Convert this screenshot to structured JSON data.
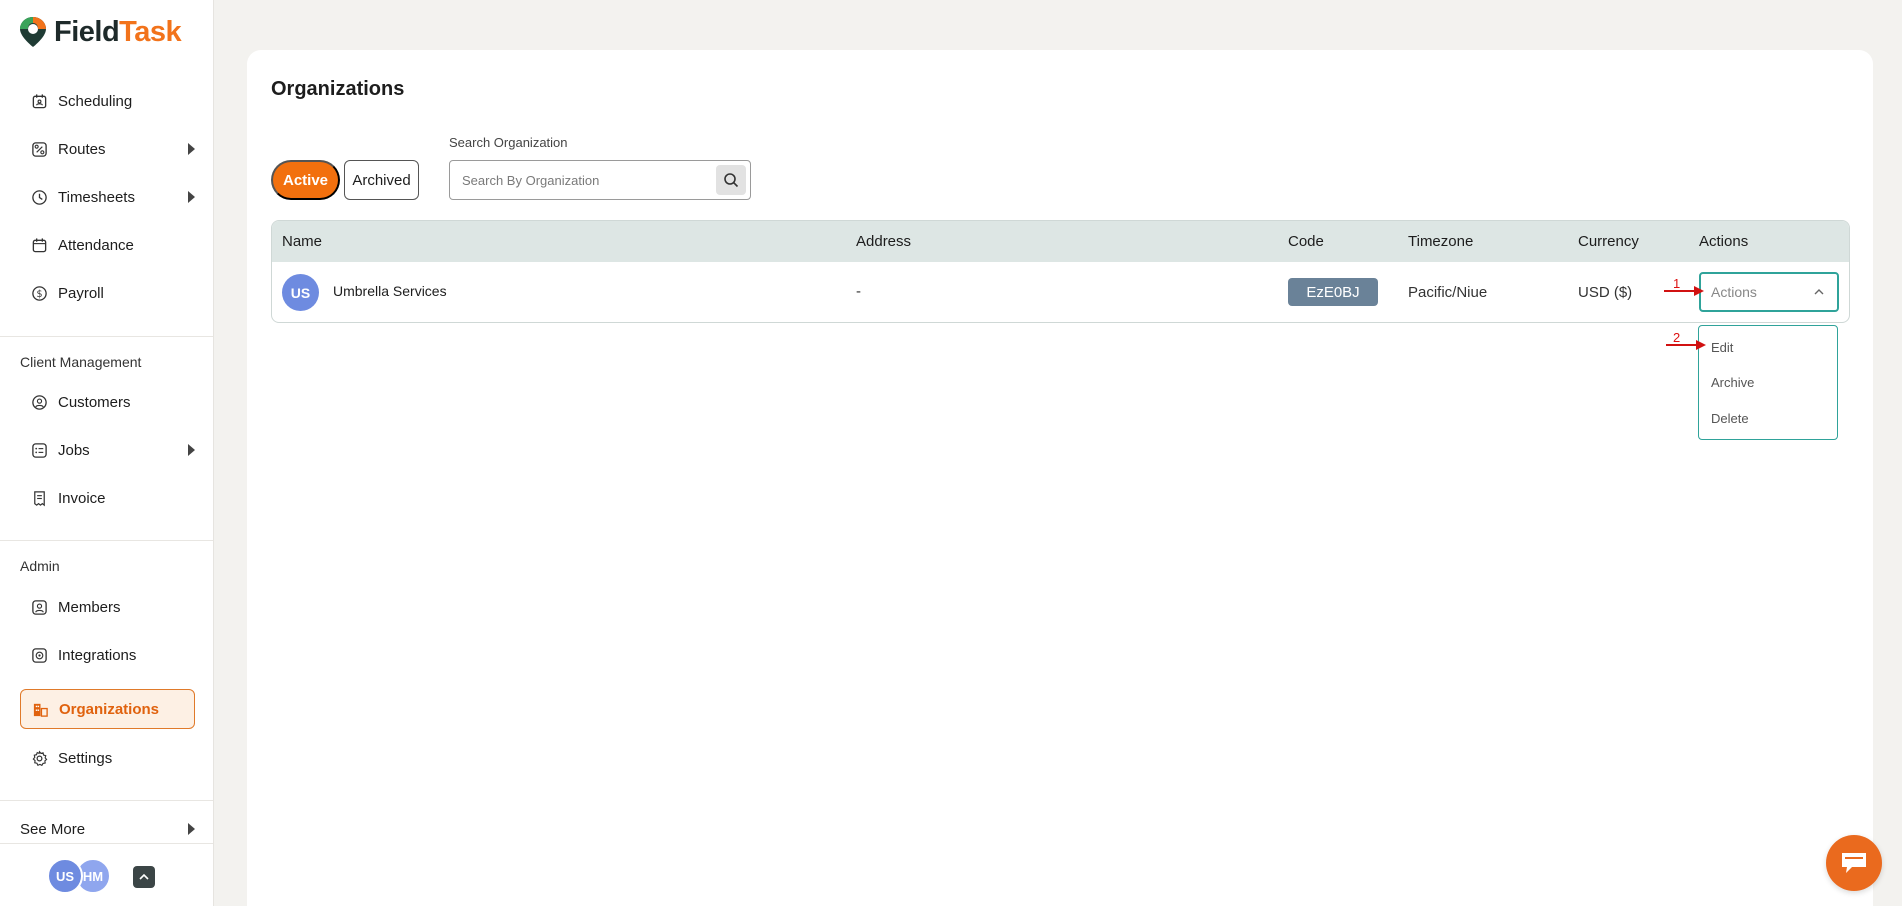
{
  "app": {
    "logo_part1": "Field",
    "logo_part2": "Task",
    "brand_color": "#f2700e"
  },
  "sidebar": {
    "main_items": [
      {
        "label": "Scheduling",
        "icon": "calendar-icon"
      },
      {
        "label": "Routes",
        "icon": "route-icon",
        "has_submenu": true
      },
      {
        "label": "Timesheets",
        "icon": "clock-icon",
        "has_submenu": true
      },
      {
        "label": "Attendance",
        "icon": "attendance-calendar-icon"
      },
      {
        "label": "Payroll",
        "icon": "dollar-icon"
      }
    ],
    "client_section_label": "Client Management",
    "client_items": [
      {
        "label": "Customers",
        "icon": "user-circle-icon"
      },
      {
        "label": "Jobs",
        "icon": "list-icon",
        "has_submenu": true
      },
      {
        "label": "Invoice",
        "icon": "receipt-icon"
      }
    ],
    "admin_section_label": "Admin",
    "admin_items": [
      {
        "label": "Members",
        "icon": "members-icon"
      },
      {
        "label": "Integrations",
        "icon": "integrations-icon"
      },
      {
        "label": "Organizations",
        "icon": "building-icon",
        "active": true
      },
      {
        "label": "Settings",
        "icon": "gear-icon"
      }
    ],
    "see_more_label": "See More",
    "user_avatars": [
      "US",
      "HM"
    ]
  },
  "page": {
    "title": "Organizations",
    "tabs": {
      "active_label": "Active",
      "archived_label": "Archived"
    },
    "search": {
      "label": "Search Organization",
      "placeholder": "Search By Organization",
      "value": ""
    }
  },
  "table": {
    "columns": [
      "Name",
      "Address",
      "Code",
      "Timezone",
      "Currency",
      "Actions"
    ],
    "rows": [
      {
        "avatar": "US",
        "name": "Umbrella Services",
        "address": "-",
        "code": "EzE0BJ",
        "timezone": "Pacific/Niue",
        "currency": "USD ($)",
        "actions_value": "Actions"
      }
    ]
  },
  "actions_dropdown": {
    "options": [
      "Edit",
      "Archive",
      "Delete"
    ]
  },
  "annotations": {
    "step1": "1",
    "step2": "2",
    "color": "#d11111"
  }
}
